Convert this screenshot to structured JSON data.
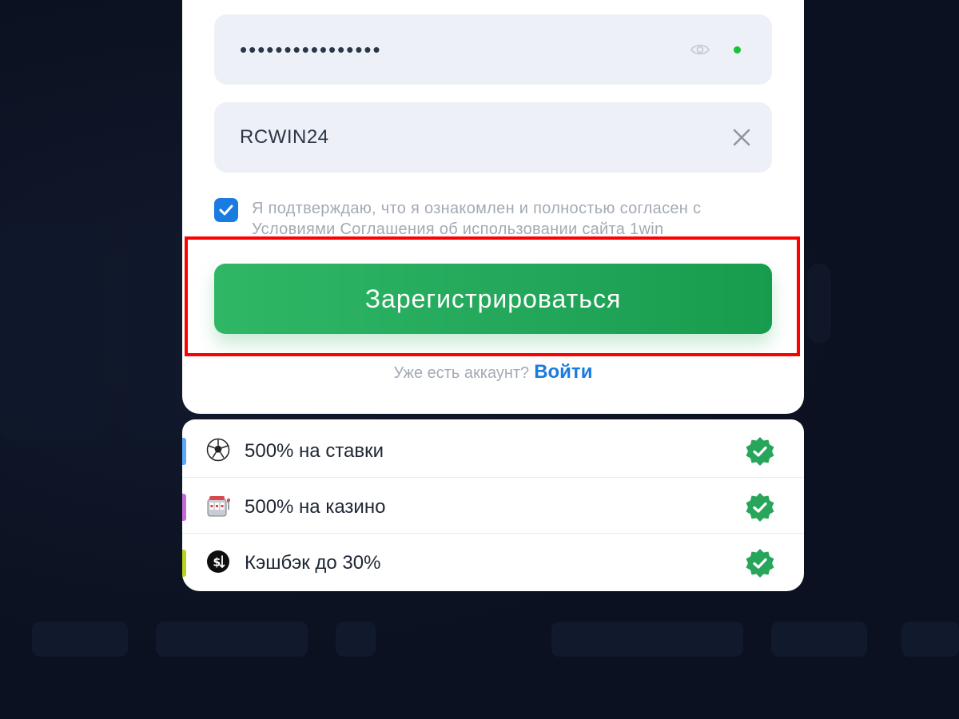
{
  "form": {
    "password_value": "••••••••••••••••",
    "promo_value": "RCWIN24",
    "terms_text": "Я подтверждаю, что я ознакомлен и полностью согласен с Условиями Соглашения об использовании сайта 1win",
    "terms_checked": true,
    "register_label": "Зарегистрироваться",
    "has_account_text": "Уже есть аккаунт?",
    "login_label": "Войти"
  },
  "bonuses": [
    {
      "icon": "soccer-ball-icon",
      "label": "500% на ставки",
      "accent": "#5aa9f5",
      "verified": true
    },
    {
      "icon": "slot-machine-icon",
      "label": "500% на казино",
      "accent": "#c56bd6",
      "verified": true
    },
    {
      "icon": "cashback-icon",
      "label": "Кэшбэк до 30%",
      "accent": "#b9d21a",
      "verified": true
    }
  ],
  "colors": {
    "brand_green": "#22a65a",
    "link_blue": "#1a7be0",
    "highlight_red": "#ff0000",
    "status_green": "#18c23a"
  }
}
